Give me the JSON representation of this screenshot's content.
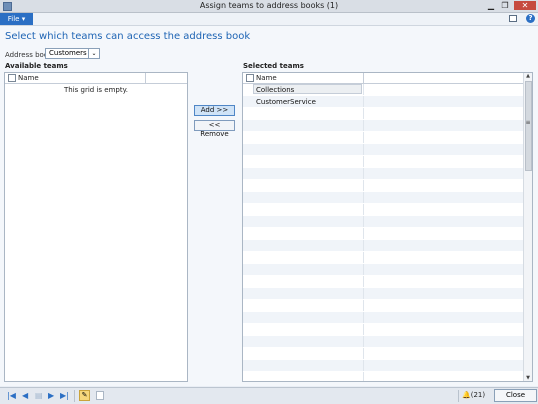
{
  "window": {
    "title": "Assign teams to address books (1)",
    "minimize": "▁",
    "restore": "❐",
    "close": "✕"
  },
  "ribbon": {
    "file_label": "File ▾",
    "help": "?"
  },
  "form": {
    "heading": "Select which teams can access the address book",
    "address_book_label": "Address book:",
    "address_book_value": "Customers",
    "dropdown_glyph": "⌄"
  },
  "available": {
    "label": "Available teams",
    "column": "Name",
    "empty_text": "This grid is empty."
  },
  "actions": {
    "add": "Add >>",
    "remove": "<< Remove"
  },
  "selected": {
    "label": "Selected teams",
    "column": "Name",
    "rows": [
      "Collections",
      "CustomerService"
    ]
  },
  "scrollbar": {
    "up": "▲",
    "down": "▼",
    "grip": "≡"
  },
  "status": {
    "first": "|◀",
    "prev": "◀",
    "mid": "▤",
    "next": "▶",
    "last": "▶|",
    "edit": "✎",
    "notifications": "🔔(21)",
    "close_label": "Close"
  }
}
